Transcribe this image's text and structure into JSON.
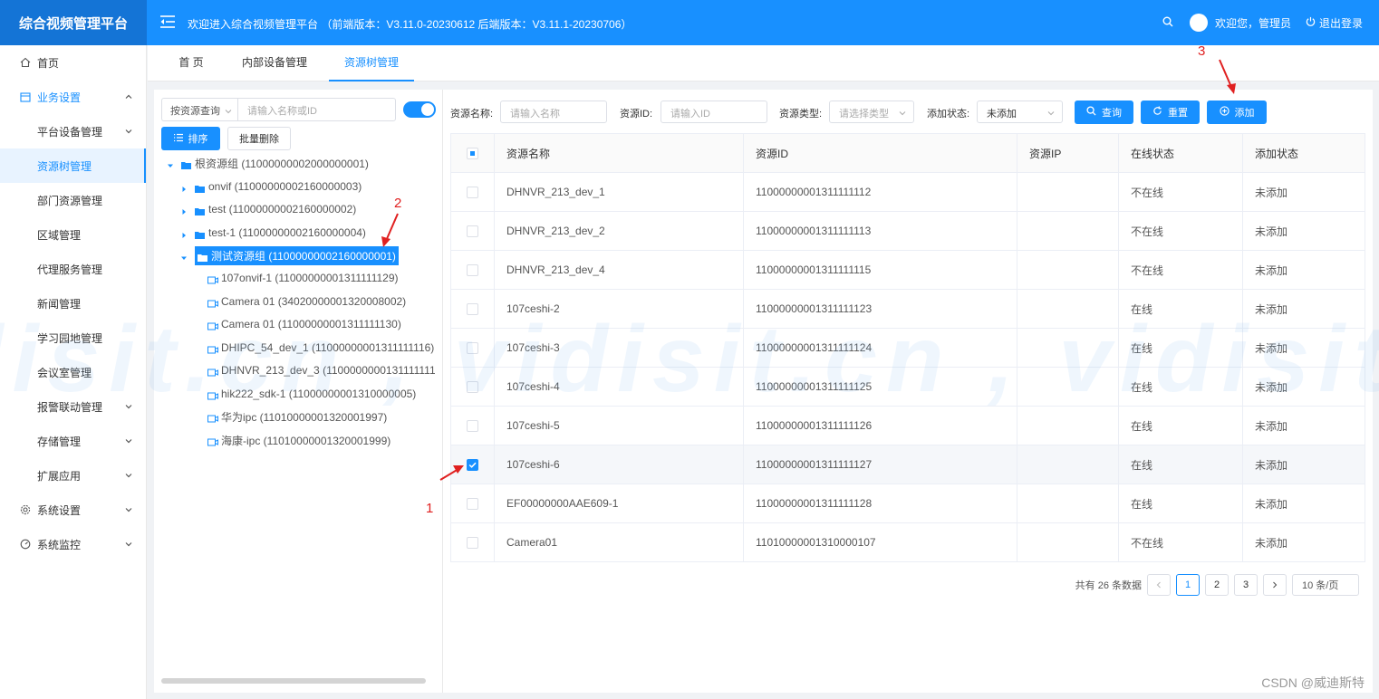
{
  "header": {
    "app_title": "综合视频管理平台",
    "welcome": "欢迎进入综合视频管理平台 （前端版本：V3.11.0-20230612 后端版本：V3.11.1-20230706）",
    "user_greeting": "欢迎您，管理员",
    "logout": "退出登录"
  },
  "sidebar": {
    "items": [
      {
        "label": "首页"
      },
      {
        "label": "业务设置"
      },
      {
        "label": "平台设备管理"
      },
      {
        "label": "资源树管理"
      },
      {
        "label": "部门资源管理"
      },
      {
        "label": "区域管理"
      },
      {
        "label": "代理服务管理"
      },
      {
        "label": "新闻管理"
      },
      {
        "label": "学习园地管理"
      },
      {
        "label": "会议室管理"
      },
      {
        "label": "报警联动管理"
      },
      {
        "label": "存储管理"
      },
      {
        "label": "扩展应用"
      },
      {
        "label": "系统设置"
      },
      {
        "label": "系统监控"
      }
    ]
  },
  "tabs": [
    {
      "label": "首 页"
    },
    {
      "label": "内部设备管理"
    },
    {
      "label": "资源树管理"
    }
  ],
  "tree_panel": {
    "query_mode": "按资源查询",
    "search_placeholder": "请输入名称或ID",
    "sort_label": "排序",
    "batch_delete_label": "批量删除",
    "nodes": [
      {
        "label": "根资源组 (11000000002000000001)"
      },
      {
        "label": "onvif (11000000002160000003)"
      },
      {
        "label": "test (11000000002160000002)"
      },
      {
        "label": "test-1 (11000000002160000004)"
      },
      {
        "label": "测试资源组 (11000000002160000001)"
      },
      {
        "label": "107onvif-1 (11000000001311111129)"
      },
      {
        "label": "Camera 01 (34020000001320008002)"
      },
      {
        "label": "Camera 01 (11000000001311111130)"
      },
      {
        "label": "DHIPC_54_dev_1 (11000000001311111116)"
      },
      {
        "label": "DHNVR_213_dev_3 (1100000000131111111"
      },
      {
        "label": "hik222_sdk-1 (11000000001310000005)"
      },
      {
        "label": "华为ipc (11010000001320001997)"
      },
      {
        "label": "海康-ipc (11010000001320001999)"
      }
    ]
  },
  "filters": {
    "name_label": "资源名称:",
    "name_placeholder": "请输入名称",
    "id_label": "资源ID:",
    "id_placeholder": "请输入ID",
    "type_label": "资源类型:",
    "type_placeholder": "请选择类型",
    "status_label": "添加状态:",
    "status_value": "未添加",
    "query_btn": "查询",
    "reset_btn": "重置",
    "add_btn": "添加"
  },
  "table": {
    "headers": [
      "资源名称",
      "资源ID",
      "资源IP",
      "在线状态",
      "添加状态"
    ],
    "rows": [
      {
        "name": "DHNVR_213_dev_1",
        "id": "11000000001311111112",
        "ip": "",
        "online": "不在线",
        "added": "未添加",
        "checked": false
      },
      {
        "name": "DHNVR_213_dev_2",
        "id": "11000000001311111113",
        "ip": "",
        "online": "不在线",
        "added": "未添加",
        "checked": false
      },
      {
        "name": "DHNVR_213_dev_4",
        "id": "11000000001311111115",
        "ip": "",
        "online": "不在线",
        "added": "未添加",
        "checked": false
      },
      {
        "name": "107ceshi-2",
        "id": "11000000001311111123",
        "ip": "",
        "online": "在线",
        "added": "未添加",
        "checked": false
      },
      {
        "name": "107ceshi-3",
        "id": "11000000001311111124",
        "ip": "",
        "online": "在线",
        "added": "未添加",
        "checked": false
      },
      {
        "name": "107ceshi-4",
        "id": "11000000001311111125",
        "ip": "",
        "online": "在线",
        "added": "未添加",
        "checked": false
      },
      {
        "name": "107ceshi-5",
        "id": "11000000001311111126",
        "ip": "",
        "online": "在线",
        "added": "未添加",
        "checked": false
      },
      {
        "name": "107ceshi-6",
        "id": "11000000001311111127",
        "ip": "",
        "online": "在线",
        "added": "未添加",
        "checked": true
      },
      {
        "name": "EF00000000AAE609-1",
        "id": "11000000001311111128",
        "ip": "",
        "online": "在线",
        "added": "未添加",
        "checked": false
      },
      {
        "name": "Camera01",
        "id": "11010000001310000107",
        "ip": "",
        "online": "不在线",
        "added": "未添加",
        "checked": false
      }
    ]
  },
  "pagination": {
    "total_text": "共有 26 条数据",
    "pages": [
      "1",
      "2",
      "3"
    ],
    "current_page": 1,
    "page_size": "10 条/页"
  },
  "annotations": {
    "step1": "1",
    "step2": "2",
    "step3": "3",
    "watermark": "disit.cn , vidisit.cn , vidisit.",
    "csdn": "CSDN @威迪斯特"
  },
  "colors": {
    "primary": "#1890ff",
    "header_logo_bg": "#1474d6",
    "annotation": "#e02020"
  }
}
